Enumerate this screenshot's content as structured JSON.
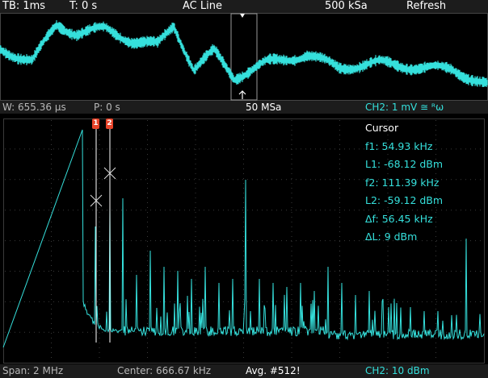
{
  "top_bar": {
    "timebase": "TB: 1ms",
    "trigger_time": "T: 0 s",
    "trigger_source": "AC Line",
    "sample_rate": "500 kSa",
    "mode": "Refresh"
  },
  "mid_bar": {
    "window": "W: 655.36 µs",
    "position": "P: 0 s",
    "fft_sample_rate": "50 MSa",
    "channel_scale": "CH2: 1 mV ≅ ᴿω"
  },
  "cursor_panel": {
    "title": "Cursor",
    "f1": "f1: 54.93 kHz",
    "l1": "L1: -68.12 dBm",
    "f2": "f2: 111.39 kHz",
    "l2": "L2: -59.12 dBm",
    "delta_f": "Δf: 56.45 kHz",
    "delta_l": "ΔL: 9 dBm",
    "cursor1_flag": "1",
    "cursor2_flag": "2"
  },
  "bottom_bar": {
    "span": "Span: 2 MHz",
    "center": "Center: 666.67 kHz",
    "averaging": "Avg. #512!",
    "channel_scale": "CH2: 10 dBm"
  },
  "colors": {
    "trace": "#35e0dc",
    "grid": "#3a3a3a",
    "cursor": "#ffffff",
    "cursor_flag": "#e8452b"
  }
}
